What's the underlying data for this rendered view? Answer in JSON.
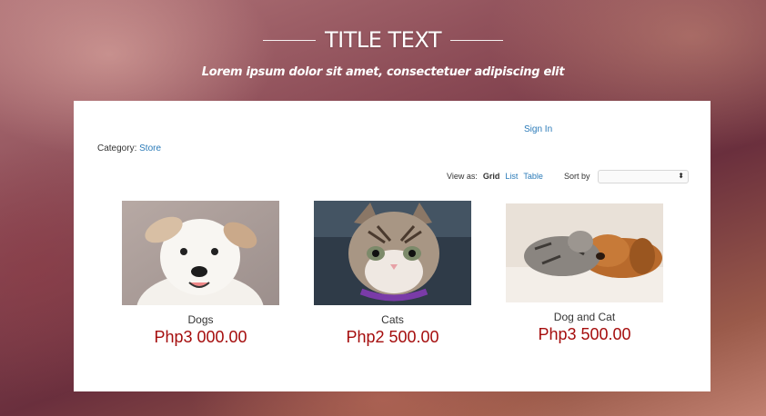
{
  "header": {
    "title": "TITLE TEXT",
    "subtitle": "Lorem ipsum dolor sit amet, consectetuer adipiscing elit"
  },
  "store": {
    "sign_in": "Sign In",
    "category_label": "Category:",
    "category_value": "Store",
    "view_as_label": "View as:",
    "view_grid": "Grid",
    "view_list": "List",
    "view_table": "Table",
    "sort_by_label": "Sort by",
    "sort_value": "",
    "sort_arrow": "⬍"
  },
  "products": [
    {
      "name": "Dogs",
      "price": "Php3 000.00",
      "image": "puppy-photo"
    },
    {
      "name": "Cats",
      "price": "Php2 500.00",
      "image": "kitten-photo"
    },
    {
      "name": "Dog and Cat",
      "price": "Php3 500.00",
      "image": "dog-and-cat-photo"
    }
  ],
  "colors": {
    "link": "#2a7ab8",
    "price": "#a50d0d"
  }
}
